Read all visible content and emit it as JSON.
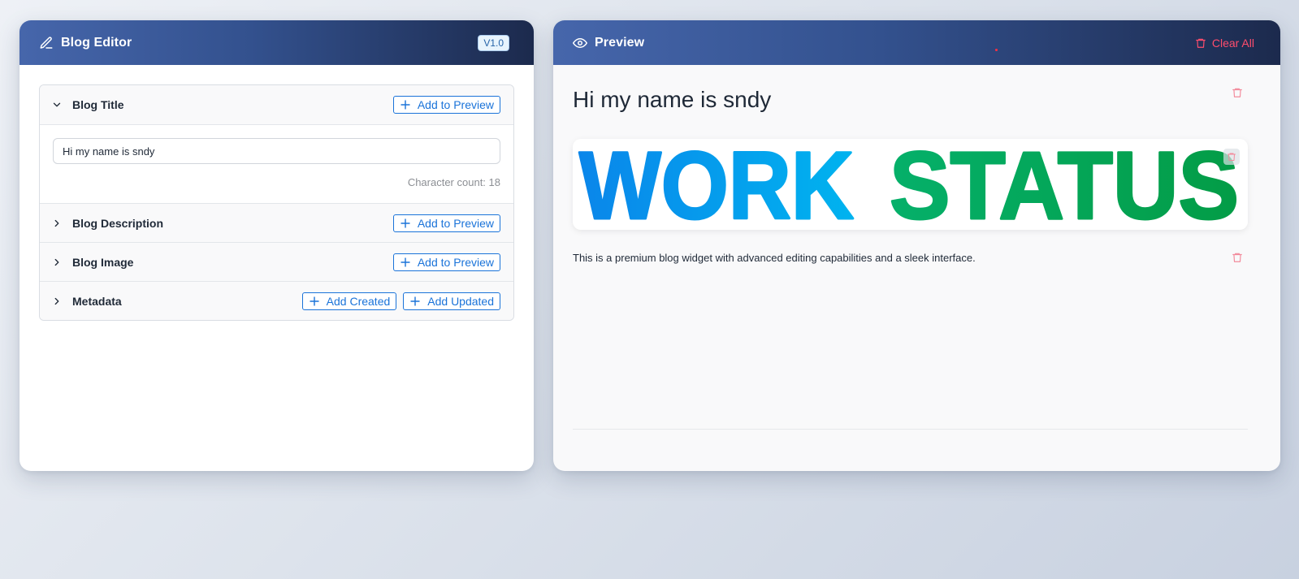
{
  "editor": {
    "title": "Blog Editor",
    "version": "V1.0",
    "sections": [
      {
        "title": "Blog Title",
        "expanded": true,
        "actions": [
          "Add to Preview"
        ]
      },
      {
        "title": "Blog Description",
        "expanded": false,
        "actions": [
          "Add to Preview"
        ]
      },
      {
        "title": "Blog Image",
        "expanded": false,
        "actions": [
          "Add to Preview"
        ]
      },
      {
        "title": "Metadata",
        "expanded": false,
        "actions": [
          "Add Created",
          "Add Updated"
        ]
      }
    ],
    "title_input_value": "Hi my name is sndy",
    "char_count": "Character count: 18"
  },
  "preview": {
    "title": "Preview",
    "clear_all": "Clear All",
    "blog_title": "Hi my name is sndy",
    "image_text": {
      "word1": "WORK",
      "word2": "STATUS"
    },
    "description": "This is a premium blog widget with advanced editing capabilities and a sleek interface."
  },
  "icons": {
    "editor_header": "edit-icon",
    "preview_header": "eye-icon",
    "clear_all": "trash-icon",
    "expand": "chevron-icon",
    "add": "plus-icon"
  },
  "colors": {
    "header_start": "#4666ab",
    "header_end": "#1c2a4d",
    "accent_blue": "#1a73d9",
    "danger": "#ff4d6d",
    "work_blue": "#0a8fea",
    "status_green": "#05a550"
  }
}
